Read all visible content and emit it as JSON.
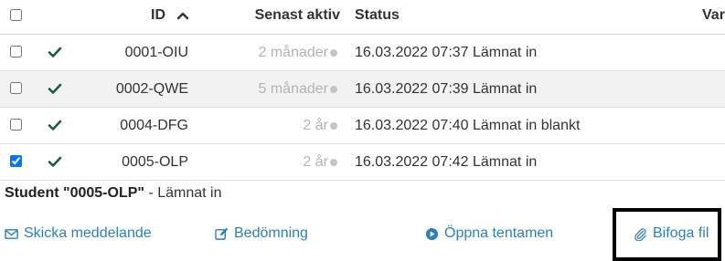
{
  "table": {
    "header": {
      "id_label": "ID",
      "last_active_label": "Senast aktiv",
      "status_label": "Status",
      "extra_label": "Var"
    },
    "rows": [
      {
        "id": "0001-OIU",
        "last_active": "2 månader",
        "status": "16.03.2022 07:37 Lämnat in",
        "checked": false
      },
      {
        "id": "0002-QWE",
        "last_active": "5 månader",
        "status": "16.03.2022 07:39 Lämnat in",
        "checked": false
      },
      {
        "id": "0004-DFG",
        "last_active": "2 år",
        "status": "16.03.2022 07:40 Lämnat in blankt",
        "checked": false
      },
      {
        "id": "0005-OLP",
        "last_active": "2 år",
        "status": "16.03.2022 07:42 Lämnat in",
        "checked": true
      }
    ]
  },
  "selected": {
    "title": "Student \"0005-OLP\"",
    "status": " - Lämnat in"
  },
  "actions": {
    "send_message": "Skicka meddelande",
    "assessment": "Bedömning",
    "open_exam": "Öppna tentamen",
    "attach_file": "Bifoga fil"
  },
  "colors": {
    "link": "#2f7fbf",
    "checkmark": "#1e5c3a",
    "muted": "#b3b3b3",
    "row_alt": "#f2f2f2"
  },
  "icons": {
    "sort": "caret-up-icon",
    "submitted": "check-icon",
    "activity": "dot-icon",
    "send_message": "envelope-icon",
    "assessment": "edit-icon",
    "open_exam": "play-circle-icon",
    "attach_file": "paperclip-icon"
  }
}
